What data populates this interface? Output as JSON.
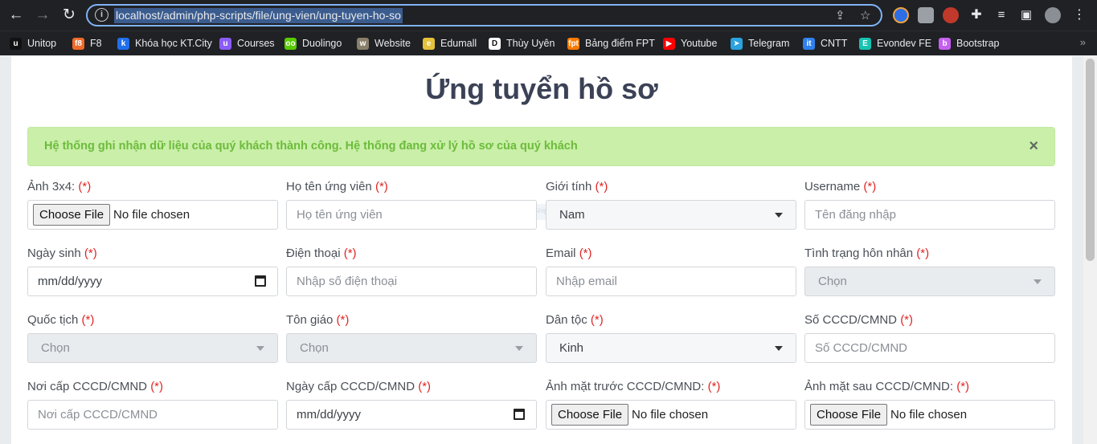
{
  "browser": {
    "url": "localhost/admin/php-scripts/file/ung-vien/ung-tuyen-ho-so",
    "bookmarks": [
      {
        "label": "Unitop",
        "color": "#111111",
        "icon_text": "u"
      },
      {
        "label": "F8",
        "color": "#f06a28",
        "icon_text": "f8"
      },
      {
        "label": "Khóa học KT.City",
        "color": "#1f6feb",
        "icon_text": "k"
      },
      {
        "label": "Courses",
        "color": "#8b5cf6",
        "icon_text": "u"
      },
      {
        "label": "Duolingo",
        "color": "#58cc02",
        "icon_text": "oo"
      },
      {
        "label": "Website",
        "color": "#8a7f6a",
        "icon_text": "w"
      },
      {
        "label": "Edumall",
        "color": "#e6c13a",
        "icon_text": "e"
      },
      {
        "label": "Thùy Uyên",
        "color": "#ffffff",
        "icon_text": "D"
      },
      {
        "label": "Bảng điểm FPT",
        "color": "#ff7a00",
        "icon_text": "fpt"
      },
      {
        "label": "Youtube",
        "color": "#ff0000",
        "icon_text": "▶"
      },
      {
        "label": "Telegram",
        "color": "#2aa3de",
        "icon_text": "➤"
      },
      {
        "label": "CNTT",
        "color": "#2f80ed",
        "icon_text": "it"
      },
      {
        "label": "Evondev FE",
        "color": "#17c3b2",
        "icon_text": "E"
      },
      {
        "label": "Bootstrap",
        "color": "#c560f0",
        "icon_text": "b"
      }
    ]
  },
  "page": {
    "title": "Ứng tuyển hồ sơ",
    "alert": "Hệ thống ghi nhận dữ liệu của quý khách thành công. Hệ thống đang xử lý hồ sơ của quý khách",
    "alert_close": "×",
    "required_mark": "(*)",
    "fields": [
      {
        "label": "Ảnh 3x4:",
        "type": "file",
        "button": "Choose File",
        "status": "No file chosen"
      },
      {
        "label": "Họ tên ứng viên",
        "type": "text",
        "placeholder": "Họ tên ứng viên"
      },
      {
        "label": "Giới tính",
        "type": "select",
        "value": "Nam"
      },
      {
        "label": "Username",
        "type": "text",
        "placeholder": "Tên đăng nhập"
      },
      {
        "label": "Ngày sinh",
        "type": "date",
        "value": "mm/dd/yyyy"
      },
      {
        "label": "Điện thoại",
        "type": "text",
        "placeholder": "Nhập số điện thoại"
      },
      {
        "label": "Email",
        "type": "text",
        "placeholder": "Nhập email"
      },
      {
        "label": "Tình trạng hôn nhân",
        "type": "select-disabled",
        "value": "Chọn"
      },
      {
        "label": "Quốc tịch",
        "type": "select-disabled",
        "value": "Chọn"
      },
      {
        "label": "Tôn giáo",
        "type": "select-disabled",
        "value": "Chọn"
      },
      {
        "label": "Dân tộc",
        "type": "select",
        "value": "Kinh"
      },
      {
        "label": "Số CCCD/CMND",
        "type": "text",
        "placeholder": "Số CCCD/CMND"
      },
      {
        "label": "Nơi cấp CCCD/CMND",
        "type": "text",
        "placeholder": "Nơi cấp CCCD/CMND"
      },
      {
        "label": "Ngày cấp CCCD/CMND",
        "type": "date",
        "value": "mm/dd/yyyy"
      },
      {
        "label": "Ảnh mặt trước CCCD/CMND:",
        "type": "file",
        "button": "Choose File",
        "status": "No file chosen"
      },
      {
        "label": "Ảnh mặt sau CCCD/CMND:",
        "type": "file",
        "button": "Choose File",
        "status": "No file chosen"
      }
    ]
  }
}
